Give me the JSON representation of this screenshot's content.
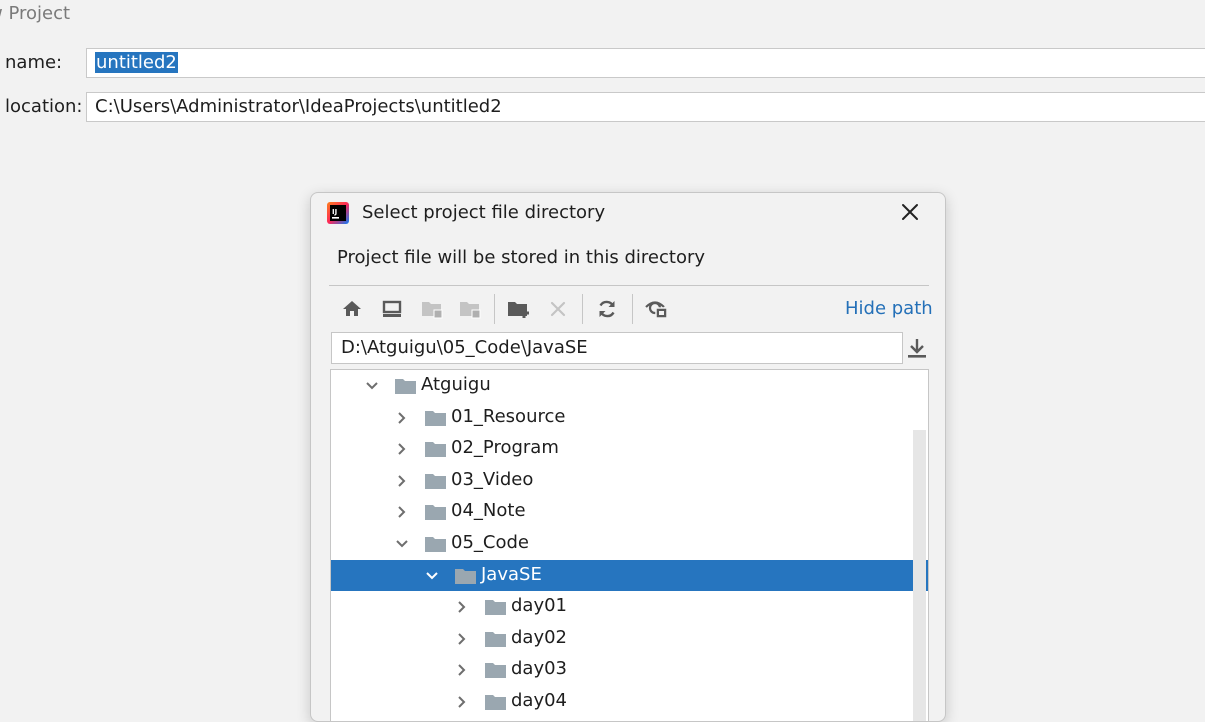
{
  "window": {
    "title": "w Project"
  },
  "form": {
    "name_label": "name:",
    "name_value": "untitled2",
    "location_label": "location:",
    "location_value": "C:\\Users\\Administrator\\IdeaProjects\\untitled2"
  },
  "dialog": {
    "title": "Select project file directory",
    "description": "Project file will be stored in this directory",
    "hide_path": "Hide path",
    "path": "D:\\Atguigu\\05_Code\\JavaSE",
    "toolbar": [
      {
        "name": "home-button",
        "icon": "home-icon"
      },
      {
        "name": "desktop-button",
        "icon": "desktop-icon"
      },
      {
        "name": "project-folder-button",
        "icon": "folder-project-icon",
        "disabled": true
      },
      {
        "name": "module-folder-button",
        "icon": "folder-module-icon",
        "disabled": true
      },
      {
        "name": "new-folder-button",
        "icon": "new-folder-icon"
      },
      {
        "name": "delete-button",
        "icon": "delete-icon",
        "disabled": true
      },
      {
        "name": "refresh-button",
        "icon": "refresh-icon"
      },
      {
        "name": "show-hidden-button",
        "icon": "show-hidden-icon"
      }
    ],
    "tree": [
      {
        "label": "Atguigu",
        "expanded": true
      },
      {
        "label": "01_Resource",
        "expanded": false
      },
      {
        "label": "02_Program",
        "expanded": false
      },
      {
        "label": "03_Video",
        "expanded": false
      },
      {
        "label": "04_Note",
        "expanded": false
      },
      {
        "label": "05_Code",
        "expanded": true
      },
      {
        "label": "JavaSE",
        "expanded": true,
        "selected": true
      },
      {
        "label": "day01",
        "expanded": false
      },
      {
        "label": "day02",
        "expanded": false
      },
      {
        "label": "day03",
        "expanded": false
      },
      {
        "label": "day04",
        "expanded": false
      }
    ]
  },
  "colors": {
    "accent": "#2675bf",
    "link": "#2470b8",
    "folder": "#9aa7b0"
  }
}
